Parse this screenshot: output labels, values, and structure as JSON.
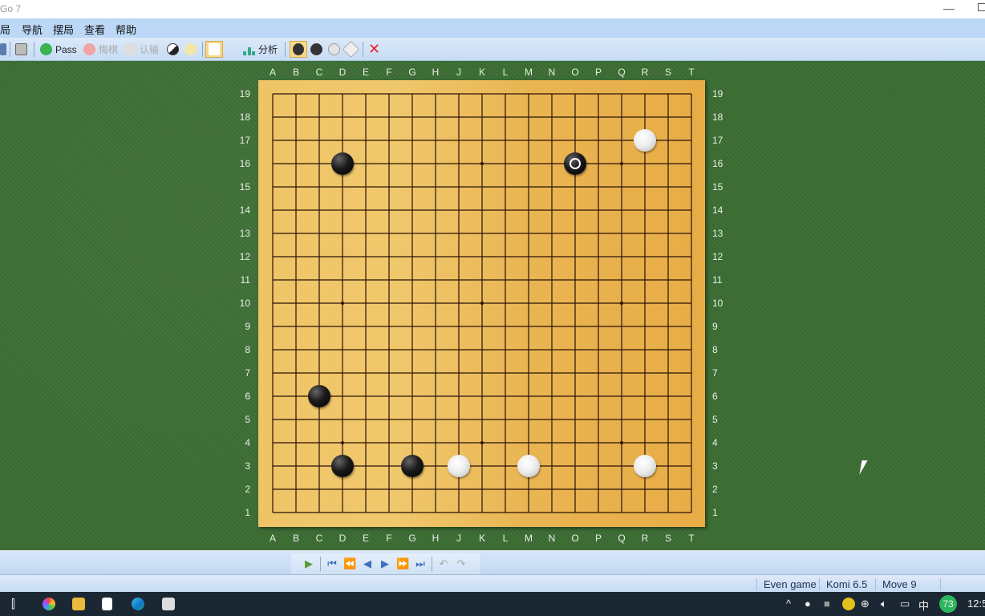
{
  "window": {
    "title": "Go 7"
  },
  "menu": [
    "局",
    "导航",
    "摆局",
    "查看",
    "帮助"
  ],
  "toolbar": {
    "pass": "Pass",
    "undo": "悔棋",
    "resign": "认输",
    "analyze": "分析"
  },
  "board": {
    "size": 19,
    "columns": [
      "A",
      "B",
      "C",
      "D",
      "E",
      "F",
      "G",
      "H",
      "J",
      "K",
      "L",
      "M",
      "N",
      "O",
      "P",
      "Q",
      "R",
      "S",
      "T"
    ],
    "rows": [
      "19",
      "18",
      "17",
      "16",
      "15",
      "14",
      "13",
      "12",
      "11",
      "10",
      "9",
      "8",
      "7",
      "6",
      "5",
      "4",
      "3",
      "2",
      "1"
    ],
    "star_points": [
      "D4",
      "K4",
      "Q4",
      "D10",
      "K10",
      "Q10",
      "D16",
      "K16",
      "Q16"
    ],
    "stones": [
      {
        "color": "black",
        "pos": "D16"
      },
      {
        "color": "black",
        "pos": "O16",
        "last_move": true
      },
      {
        "color": "white",
        "pos": "R17"
      },
      {
        "color": "black",
        "pos": "C6"
      },
      {
        "color": "black",
        "pos": "D3"
      },
      {
        "color": "black",
        "pos": "G3"
      },
      {
        "color": "white",
        "pos": "J3"
      },
      {
        "color": "white",
        "pos": "M3"
      },
      {
        "color": "white",
        "pos": "R3"
      }
    ]
  },
  "status": {
    "game": "Even game",
    "komi": "Komi 6.5",
    "move": "Move 9"
  },
  "taskbar": {
    "clock": "12:5",
    "badge": "73",
    "ime": "中"
  }
}
